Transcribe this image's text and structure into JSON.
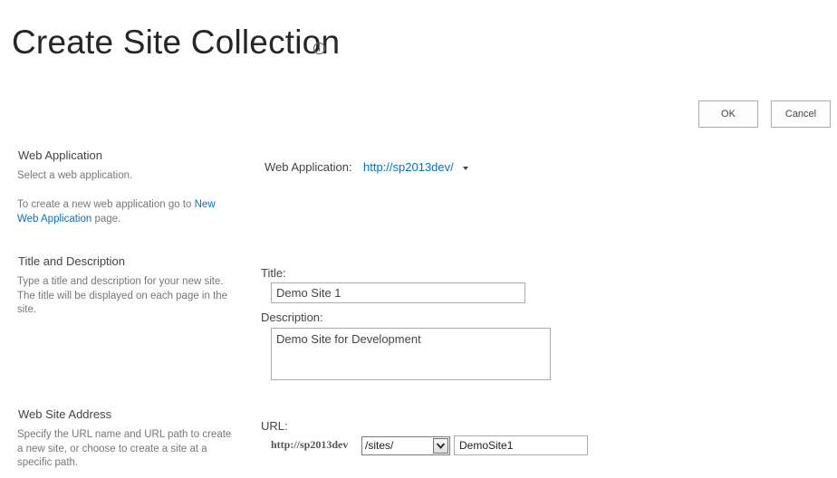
{
  "header": {
    "title": "Create Site Collection",
    "info_icon": "info-circle-icon"
  },
  "toolbar": {
    "ok_label": "OK",
    "cancel_label": "Cancel"
  },
  "sections": {
    "web_application": {
      "title": "Web Application",
      "desc": "Select a web application.",
      "hint_prefix": "To create a new web application go to ",
      "hint_link_1": "New",
      "hint_link_2": "Web Application",
      "hint_suffix": " page.",
      "field_label": "Web Application:",
      "value": "http://sp2013dev/",
      "dropdown_icon": "caret-down-icon"
    },
    "title_description": {
      "title": "Title and Description",
      "desc_line1": "Type a title and description for your new site.",
      "desc_line2": "The title will be displayed on each page in the",
      "desc_line3": "site.",
      "title_label": "Title:",
      "title_value": "Demo Site 1",
      "description_label": "Description:",
      "description_value": "Demo Site for Development"
    },
    "web_site_address": {
      "title": "Web Site Address",
      "desc_line1": "Specify the URL name and URL path to create",
      "desc_line2": "a new site, or choose to create a site at a",
      "desc_line3": "specific path.",
      "url_label": "URL:",
      "url_prefix": "http://sp2013dev",
      "path_selected": "/sites/",
      "site_name_value": "DemoSite1",
      "dropdown_icon": "chevron-down-icon"
    }
  }
}
